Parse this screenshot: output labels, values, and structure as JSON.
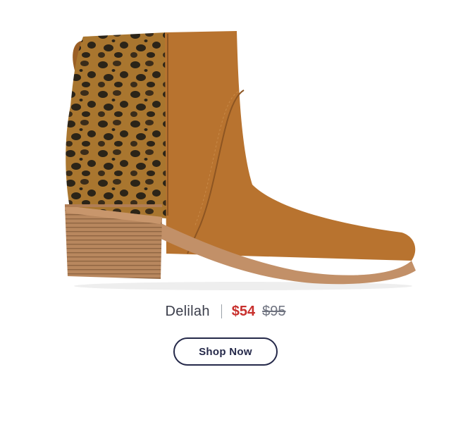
{
  "product": {
    "name": "Delilah",
    "sale_price": "$54",
    "original_price": "$95",
    "image_alt": "Delilah leopard-print ankle boot",
    "colors": {
      "suede": "#b8732f",
      "leopard_base": "#a9762f",
      "leopard_spot": "#2b2418",
      "heel": "#b8875e",
      "sale_red": "#c8302d",
      "navy": "#25294a"
    }
  },
  "cta": {
    "label": "Shop Now"
  }
}
